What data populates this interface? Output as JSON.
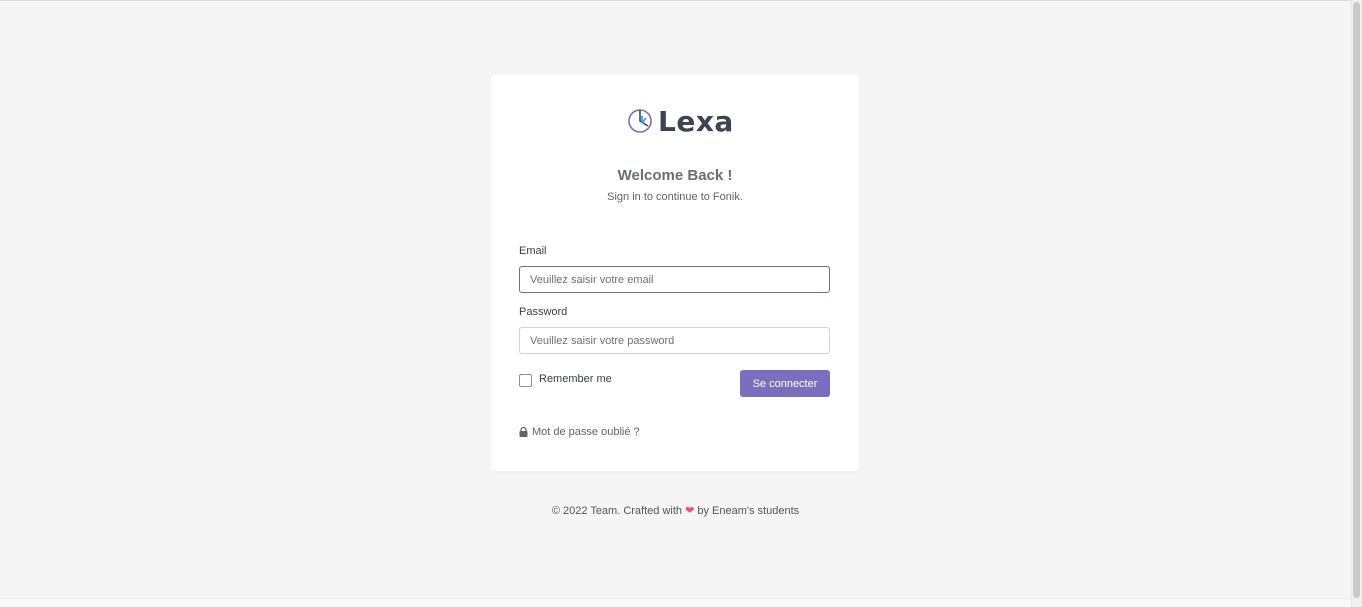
{
  "brand": {
    "name": "Lexa"
  },
  "auth": {
    "title": "Welcome Back !",
    "subtitle": "Sign in to continue to Fonik.",
    "email": {
      "label": "Email",
      "placeholder": "Veuillez saisir votre email",
      "value": ""
    },
    "password": {
      "label": "Password",
      "placeholder": "Veuillez saisir votre password",
      "value": ""
    },
    "remember": {
      "label": "Remember me",
      "checked": false
    },
    "submit_label": "Se connecter",
    "forgot_label": "Mot de passe oublié ?"
  },
  "footer": {
    "before_heart": "© 2022 Team. Crafted with",
    "heart_icon": "heart-icon",
    "after_heart": "by Eneam's students"
  },
  "colors": {
    "accent": "#7a6fbe",
    "heart": "#f0506e",
    "text_dark": "#3e4451",
    "background": "#f5f5f5"
  }
}
